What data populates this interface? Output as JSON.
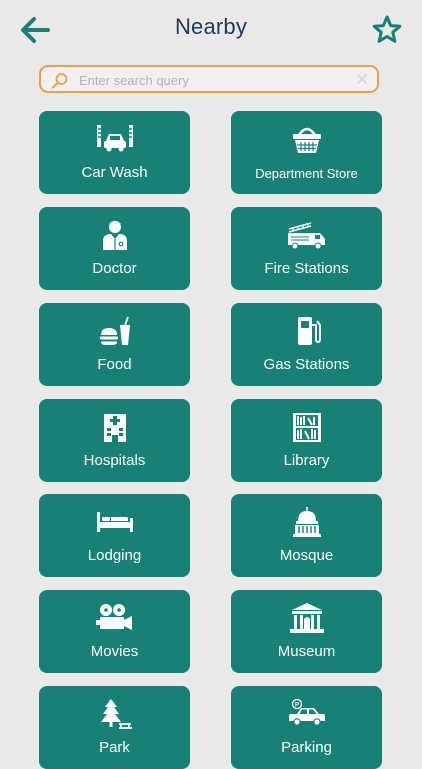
{
  "header": {
    "title": "Nearby",
    "back_icon": "arrow-left-icon",
    "favorite_icon": "star-outline-icon",
    "accent_color": "#178176"
  },
  "search": {
    "placeholder": "Enter search query",
    "value": "",
    "icon": "search-icon",
    "clear_icon": "close-icon",
    "border_color": "#e8a24f"
  },
  "tiles": [
    {
      "label": "Car Wash",
      "icon": "car-wash-icon"
    },
    {
      "label": "Department Store",
      "icon": "shopping-basket-icon"
    },
    {
      "label": "Doctor",
      "icon": "doctor-icon"
    },
    {
      "label": "Fire Stations",
      "icon": "fire-truck-icon"
    },
    {
      "label": "Food",
      "icon": "fast-food-icon"
    },
    {
      "label": "Gas Stations",
      "icon": "gas-pump-icon"
    },
    {
      "label": "Hospitals",
      "icon": "hospital-icon"
    },
    {
      "label": "Library",
      "icon": "bookshelf-icon"
    },
    {
      "label": "Lodging",
      "icon": "bed-icon"
    },
    {
      "label": "Mosque",
      "icon": "mosque-dome-icon"
    },
    {
      "label": "Movies",
      "icon": "film-projector-icon"
    },
    {
      "label": "Museum",
      "icon": "museum-building-icon"
    },
    {
      "label": "Park",
      "icon": "park-tree-icon"
    },
    {
      "label": "Parking",
      "icon": "parking-car-icon"
    }
  ]
}
